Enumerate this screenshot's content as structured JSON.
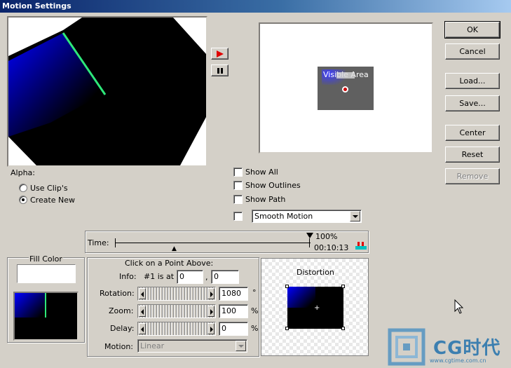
{
  "window": {
    "title": "Motion Settings"
  },
  "buttons": {
    "ok": "OK",
    "cancel": "Cancel",
    "load": "Load...",
    "save": "Save...",
    "center": "Center",
    "reset": "Reset",
    "remove": "Remove"
  },
  "preview": {
    "visible_area_label": "Visible Area"
  },
  "alpha": {
    "label": "Alpha:",
    "options": [
      {
        "label": "Use Clip's",
        "selected": false
      },
      {
        "label": "Create New",
        "selected": true
      }
    ]
  },
  "checkboxes": [
    {
      "label": "Show All",
      "checked": false
    },
    {
      "label": "Show Outlines",
      "checked": false
    },
    {
      "label": "Show Path",
      "checked": false
    }
  ],
  "motion_mode": {
    "checked": false,
    "value": "Smooth Motion"
  },
  "time": {
    "label": "Time:",
    "percent": "100%",
    "timecode": "00:10:13"
  },
  "fill_color": {
    "label": "Fill Color",
    "swatch": "#ffffff"
  },
  "point": {
    "heading": "Click on a Point Above:",
    "info_label": "Info:",
    "info_text": "#1 is at",
    "x": "0",
    "comma": ",",
    "y": "0",
    "rotation_label": "Rotation:",
    "rotation_value": "1080",
    "rotation_unit": "°",
    "zoom_label": "Zoom:",
    "zoom_value": "100",
    "zoom_unit": "%",
    "delay_label": "Delay:",
    "delay_value": "0",
    "delay_unit": "%",
    "motion_label": "Motion:",
    "motion_value": "Linear"
  },
  "distortion": {
    "label": "Distortion"
  },
  "watermark": {
    "brand": "CG时代",
    "url": "www.cgtime.com.cn"
  },
  "colors": {
    "accent_blue": "#0000ff",
    "path_green": "#2ee87a",
    "play_red": "#e00000"
  }
}
